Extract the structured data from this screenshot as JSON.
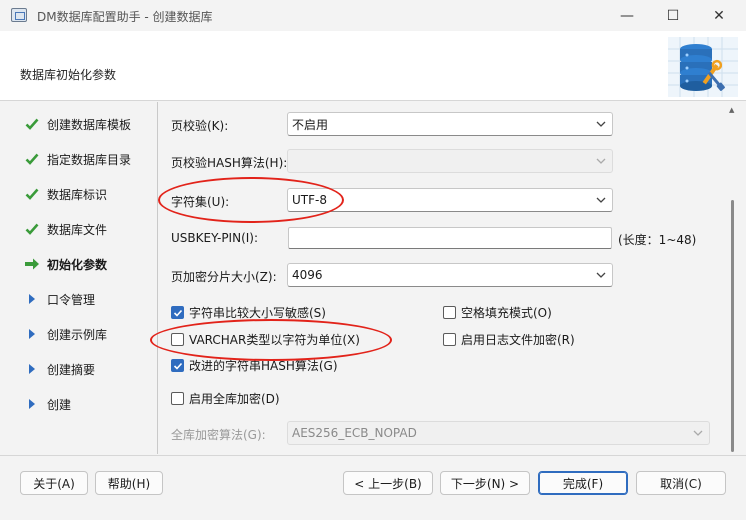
{
  "window": {
    "title": "DM数据库配置助手 - 创建数据库",
    "minimize": "—",
    "maximize": "☐",
    "close": "✕"
  },
  "header": {
    "title": "数据库初始化参数"
  },
  "sidebar": {
    "items": [
      {
        "label": "创建数据库模板",
        "state": "done"
      },
      {
        "label": "指定数据库目录",
        "state": "done"
      },
      {
        "label": "数据库标识",
        "state": "done"
      },
      {
        "label": "数据库文件",
        "state": "done"
      },
      {
        "label": "初始化参数",
        "state": "current"
      },
      {
        "label": "口令管理",
        "state": "pending"
      },
      {
        "label": "创建示例库",
        "state": "pending"
      },
      {
        "label": "创建摘要",
        "state": "pending"
      },
      {
        "label": "创建",
        "state": "pending"
      }
    ]
  },
  "form": {
    "page_check_label": "页校验(K):",
    "page_check_value": "不启用",
    "page_hash_label": "页校验HASH算法(H):",
    "page_hash_value": "",
    "charset_label": "字符集(U):",
    "charset_value": "UTF-8",
    "usbkey_label": "USBKEY-PIN(I):",
    "usbkey_value": "",
    "usbkey_hint": "(长度：1~48)",
    "page_encrypt_label": "页加密分片大小(Z):",
    "page_encrypt_value": "4096",
    "case_sensitive_label": "字符串比较大小写敏感(S)",
    "case_sensitive_checked": true,
    "space_pad_label": "空格填充模式(O)",
    "space_pad_checked": false,
    "varchar_char_label": "VARCHAR类型以字符为单位(X)",
    "varchar_char_checked": false,
    "log_encrypt_label": "启用日志文件加密(R)",
    "log_encrypt_checked": false,
    "improved_hash_label": "改进的字符串HASH算法(G)",
    "improved_hash_checked": true,
    "full_encrypt_label": "启用全库加密(D)",
    "full_encrypt_checked": false,
    "full_encrypt_algo_label": "全库加密算法(G):",
    "full_encrypt_algo_value": "AES256_ECB_NOPAD"
  },
  "footer": {
    "about": "关于(A)",
    "help": "帮助(H)",
    "prev": "< 上一步(B)",
    "next": "下一步(N) >",
    "finish": "完成(F)",
    "cancel": "取消(C)"
  },
  "colors": {
    "check_green": "#3a9b3a",
    "arrow_green": "#3a9b3a",
    "pending_blue": "#2f6cbf",
    "annotation_red": "#e2231a",
    "checkbox_blue": "#2f6cbf"
  }
}
